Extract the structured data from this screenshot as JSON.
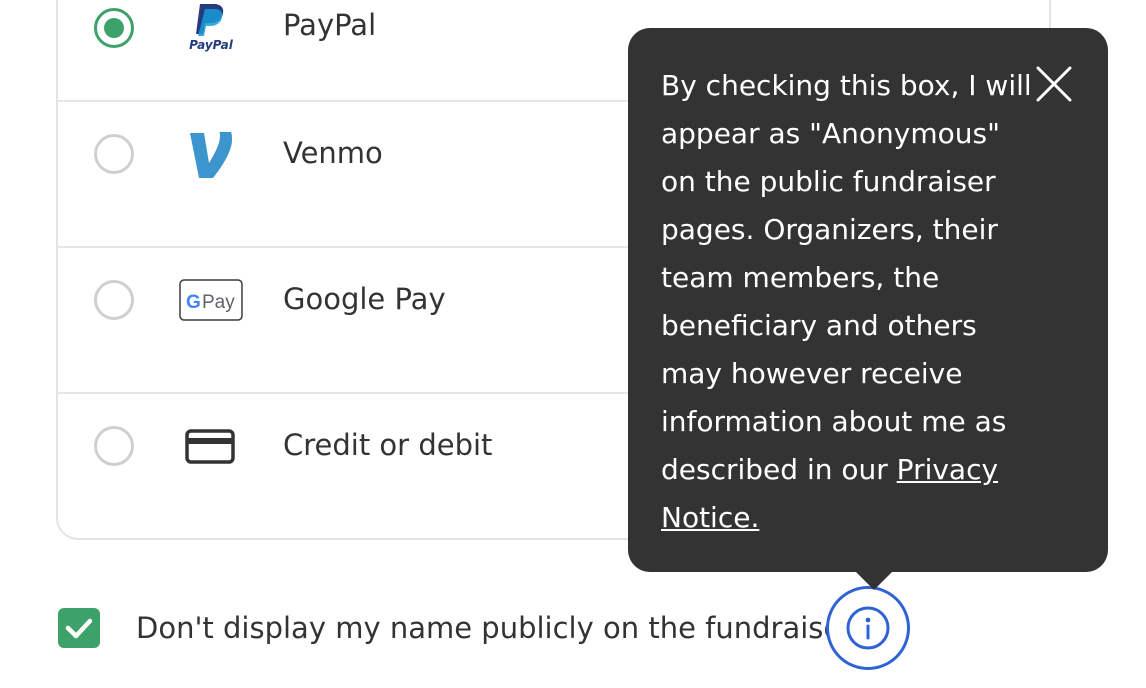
{
  "payment_methods": [
    {
      "label": "PayPal",
      "icon": "paypal-logo-icon",
      "selected": true
    },
    {
      "label": "Venmo",
      "icon": "venmo-logo-icon",
      "selected": false
    },
    {
      "label": "Google Pay",
      "icon": "google-pay-logo-icon",
      "selected": false
    },
    {
      "label": "Credit or debit",
      "icon": "credit-card-icon",
      "selected": false
    }
  ],
  "paypal_logo_text": "PayPal",
  "gpay_logo_text": "Pay",
  "anonymous": {
    "label": "Don't display my name publicly on the fundraiser.",
    "checked": true
  },
  "tooltip": {
    "text": "By checking this box, I will appear as \"Anonymous\" on the public fundraiser pages. Organizers, their team members, the beneficiary and others may however receive information about me as described in our",
    "link_text": "Privacy Notice."
  },
  "colors": {
    "accent_green": "#3da16a",
    "info_blue": "#2f63d5",
    "tooltip_bg": "#333333",
    "venmo_blue": "#3d95ce",
    "paypal_dark": "#253b80",
    "paypal_light": "#179bd7"
  }
}
